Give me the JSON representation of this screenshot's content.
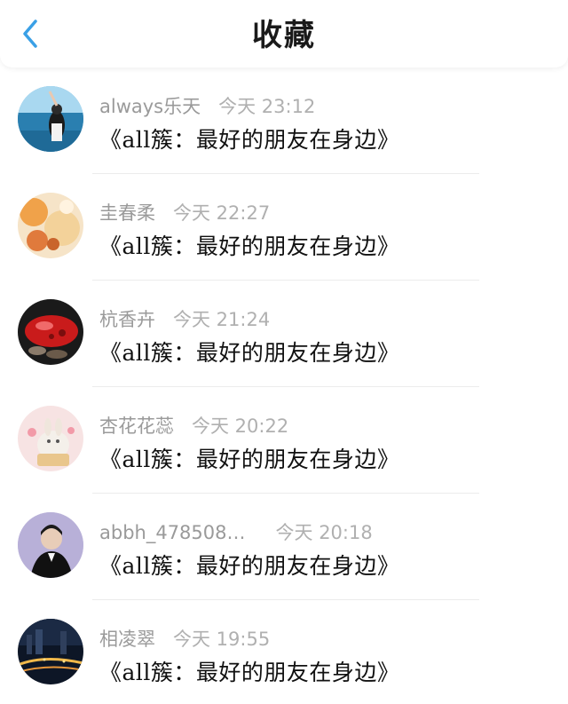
{
  "header": {
    "title": "收藏",
    "back_icon": "chevron-left-icon",
    "accent_color": "#3aa0e6"
  },
  "favorites": [
    {
      "username": "always乐天",
      "time": "今天 23:12",
      "title": "《all簇：最好的朋友在身边》"
    },
    {
      "username": "圭春柔",
      "time": "今天 22:27",
      "title": "《all簇：最好的朋友在身边》"
    },
    {
      "username": "杭香卉",
      "time": "今天 21:24",
      "title": "《all簇：最好的朋友在身边》"
    },
    {
      "username": "杏花花蕊",
      "time": "今天 20:22",
      "title": "《all簇：最好的朋友在身边》"
    },
    {
      "username": "abbh_478508…",
      "time": "今天 20:18",
      "title": "《all簇：最好的朋友在身边》"
    },
    {
      "username": "相凌翠",
      "time": "今天 19:55",
      "title": "《all簇：最好的朋友在身边》"
    }
  ]
}
